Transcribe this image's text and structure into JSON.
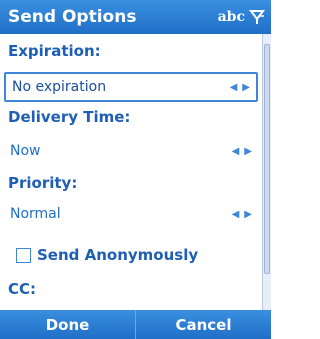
{
  "title": "Send Options",
  "input_mode": "abc",
  "expiration": {
    "label": "Expiration:",
    "value": "No expiration"
  },
  "delivery": {
    "label": "Delivery Time:",
    "value": "Now"
  },
  "priority": {
    "label": "Priority:",
    "value": "Normal"
  },
  "send_anonymously": {
    "label": "Send Anonymously",
    "checked": false
  },
  "cc": {
    "label": "CC:"
  },
  "softkeys": {
    "left": "Done",
    "right": "Cancel"
  },
  "colors": {
    "bar_blue": "#1f6fc6",
    "label_blue": "#1e5fb5",
    "focus_border": "#3d86d8"
  }
}
